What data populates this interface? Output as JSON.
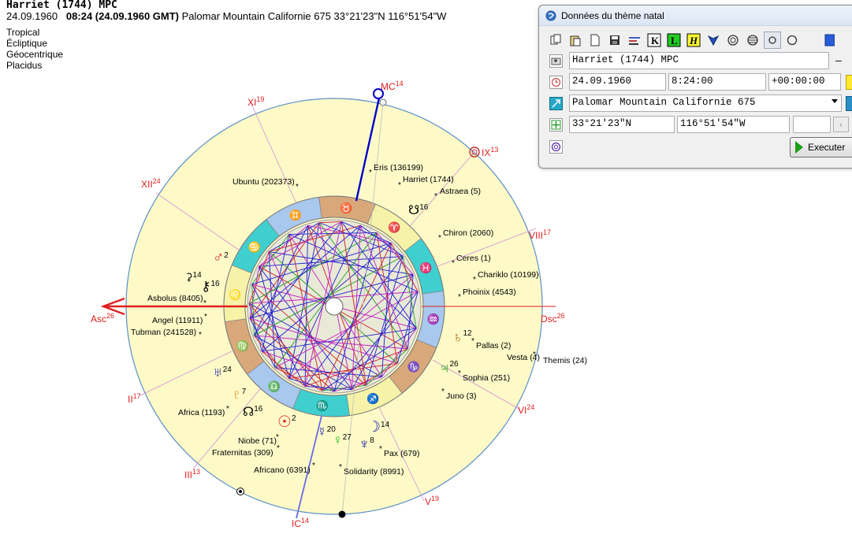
{
  "header": {
    "name": "Harriet (1744) MPC",
    "date": "24.09.1960",
    "time_info": "08:24 (24.09.1960 GMT)",
    "place_coords": "Palomar Mountain Californie 675 33°21'23\"N  116°51'54\"W",
    "options": [
      "Tropical",
      "Écliptique",
      "Géocentrique",
      "Placidus"
    ]
  },
  "chart": {
    "angles": {
      "mc": {
        "label": "MC",
        "deg": "14"
      },
      "ic": {
        "label": "IC",
        "deg": "14"
      },
      "asc": {
        "label": "Asc",
        "deg": "26"
      },
      "dsc": {
        "label": "Dsc",
        "deg": "26"
      }
    },
    "houses": [
      {
        "label": "XI",
        "deg": "19"
      },
      {
        "label": "XII",
        "deg": "24"
      },
      {
        "label": "II",
        "deg": "17"
      },
      {
        "label": "III",
        "deg": "13"
      },
      {
        "label": "V",
        "deg": "19"
      },
      {
        "label": "VI",
        "deg": "24"
      },
      {
        "label": "VIII",
        "deg": "17"
      },
      {
        "label": "IX",
        "deg": "13"
      }
    ],
    "zodiac_signs": [
      "♉",
      "♈",
      "♓",
      "♒",
      "♑",
      "♐",
      "♏",
      "♎",
      "♍",
      "♌",
      "♋",
      "♊"
    ],
    "planets": [
      {
        "glyph": "♂",
        "deg": "2",
        "color": "#e02020"
      },
      {
        "glyph": "⚳",
        "deg": "14",
        "color": "#000000"
      },
      {
        "glyph": "⚷",
        "deg": "16",
        "color": "#000000"
      },
      {
        "glyph": "♅",
        "deg": "24",
        "color": "#1c1ca0"
      },
      {
        "glyph": "♇",
        "deg": "7",
        "color": "#f08000"
      },
      {
        "glyph": "☊",
        "deg": "16",
        "color": "#000000"
      },
      {
        "glyph": "☉",
        "deg": "2",
        "color": "#e02020"
      },
      {
        "glyph": "☿",
        "deg": "20",
        "color": "#1c1ca0"
      },
      {
        "glyph": "♀",
        "deg": "27",
        "color": "#20c020"
      },
      {
        "glyph": "☽",
        "deg": "14",
        "color": "#1c1ca0"
      },
      {
        "glyph": "♆",
        "deg": "8",
        "color": "#1c1ca0"
      },
      {
        "glyph": "♄",
        "deg": "12",
        "color": "#b05a00"
      },
      {
        "glyph": "♃",
        "deg": "26",
        "color": "#0a8a0a"
      },
      {
        "glyph": "☋",
        "deg": "16",
        "color": "#000000"
      }
    ],
    "asteroids": [
      "Eris (136199)",
      "Harriet (1744)",
      "Astraea (5)",
      "Ubuntu (202373)",
      "Chiron (2060)",
      "Ceres (1)",
      "Chariklo (10199)",
      "Phoinix (4543)",
      "Asbolus (8405)",
      "Angel (11911)",
      "Tubman (241528)",
      "Pallas (2)",
      "Vesta (4)",
      "Themis (24)",
      "Sophia (251)",
      "Juno (3)",
      "Africa (1193)",
      "Niobe (71)",
      "Fraternitas (309)",
      "Pax (679)",
      "Africano (6391)",
      "Solidarity (8991)"
    ]
  },
  "dialog": {
    "title": "Données du thème natal",
    "toolbar": [
      {
        "name": "copy-icon"
      },
      {
        "name": "paste-icon"
      },
      {
        "name": "new-icon"
      },
      {
        "name": "save-icon"
      },
      {
        "name": "settings-icon"
      },
      {
        "name": "k-icon",
        "text": "K"
      },
      {
        "name": "l-icon",
        "text": "L"
      },
      {
        "name": "h-icon",
        "text": "H"
      },
      {
        "name": "shield-icon"
      },
      {
        "name": "circle-spiral-icon"
      },
      {
        "name": "circle-cross-icon"
      },
      {
        "name": "small-circle-icon"
      },
      {
        "name": "empty-circle-icon"
      }
    ],
    "name_value": "Harriet (1744) MPC",
    "side_dash": "–",
    "date_value": "24.09.1960",
    "time_value": "8:24:00",
    "offset_value": "+00:00:00",
    "place_value": "Palomar Mountain Californie 675",
    "lat_value": "33°21'23\"N",
    "lon_value": "116°51'54\"W",
    "extra_value": "",
    "execute_label": "Executer",
    "colors": {
      "toolbar_k": "#ffffff",
      "toolbar_l": "#22cc22",
      "toolbar_h": "#ffff33"
    }
  }
}
